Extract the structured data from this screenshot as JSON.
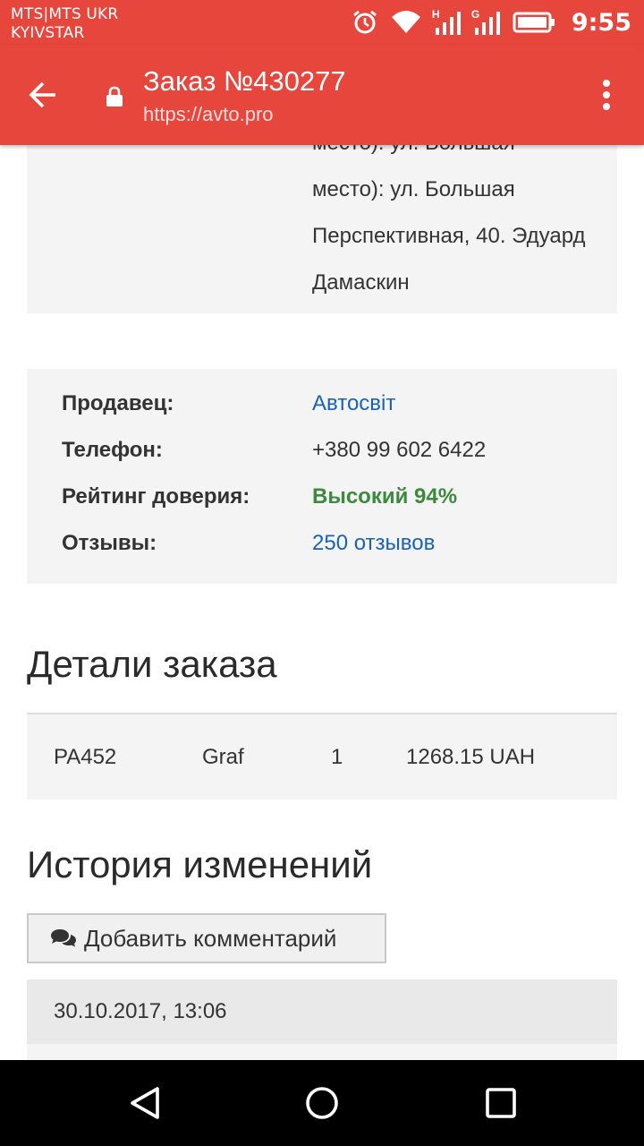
{
  "status_bar": {
    "carrier_line1": "MTS|MTS UKR",
    "carrier_line2": "KYIVSTAR",
    "signal1_tech": "H",
    "signal2_tech": "G",
    "time": "9:55",
    "icons": [
      "alarm-icon",
      "wifi-icon",
      "signal-icon",
      "signal-icon",
      "battery-icon"
    ]
  },
  "app_bar": {
    "title": "Заказ №430277",
    "url": "https://avto.pro",
    "icons": [
      "back-arrow-icon",
      "lock-icon",
      "more-vert-icon"
    ]
  },
  "address_card": {
    "lines": [
      "место): ул. Большая",
      "Перспективная, 40. Эдуард",
      "Дамаскин"
    ]
  },
  "seller": {
    "seller_label": "Продавец:",
    "seller_value": "Автосвіт",
    "phone_label": "Телефон:",
    "phone_value": "+380 99 602 6422",
    "rating_label": "Рейтинг доверия:",
    "rating_value": "Высокий 94%",
    "reviews_label": "Отзывы:",
    "reviews_value": "250 отзывов"
  },
  "details": {
    "heading": "Детали заказа",
    "row": {
      "code": "PA452",
      "brand": "Graf",
      "qty": "1",
      "price": "1268.15 UAH"
    }
  },
  "history": {
    "heading": "История изменений",
    "add_comment_label": "Добавить комментарий",
    "entry_date": "30.10.2017, 13:06"
  },
  "colors": {
    "accent": "#e6463c",
    "link": "#1a63b4",
    "positive": "#3d8a3f",
    "card_bg": "#f4f4f4"
  }
}
